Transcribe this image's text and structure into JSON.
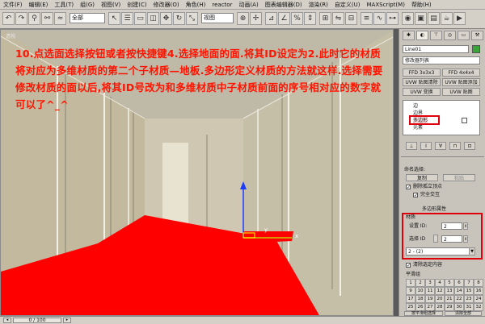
{
  "menu": [
    "文件(F)",
    "编辑(E)",
    "工具(T)",
    "组(G)",
    "视图(V)",
    "创建(C)",
    "修改器(O)",
    "角色(H)",
    "reactor",
    "动画(A)",
    "图表编辑器(D)",
    "渲染(R)",
    "自定义(U)",
    "MAXScript(M)",
    "帮助(H)"
  ],
  "toolbar": {
    "selection_filter": "全部",
    "coord_system": "视图"
  },
  "viewport": {
    "label": "透视",
    "instruction": "10.点选面选择按钮或者按快捷键4.选择地面的面.将其ID设定为2.此时它的材质将对应为多维材质的第二个子材质—地板.多边形定义材质的方法就这样.选择需要修改材质的面以后,将其ID号改为和多维材质中子材质前面的序号相对应的数字就可以了^_^",
    "axis_x": "x",
    "axis_y": "y"
  },
  "panel": {
    "object_name": "Line01",
    "modifier_list": "修改器列表",
    "btn_ffd333": "FFD 3x3x3",
    "btn_ffd444": "FFD 4x4x4",
    "btn_uvw_clear": "UVW 贴图清除",
    "btn_uvw_add": "UVW 贴图添加",
    "btn_uvw_xform": "UVW 变换",
    "btn_uvw_map": "UVW 贴图",
    "stack": [
      "边",
      "边界",
      "多边形",
      "元素"
    ],
    "named_selection": "命名选择:",
    "copy": "复制",
    "paste": "粘贴",
    "delete_isolated": "删除孤立顶点",
    "full_interact": "完全交互",
    "poly_props": "多边形属性",
    "material": "材质",
    "set_id_label": "设置 ID:",
    "set_id_value": "2",
    "select_id_label": "选择 ID",
    "select_id_value": "2",
    "submaterial": "2 - (2)",
    "clear_selection": "清除选定内容",
    "smoothing_groups": "平滑组",
    "numbers": [
      "1",
      "2",
      "3",
      "4",
      "5",
      "6",
      "7",
      "8",
      "9",
      "10",
      "11",
      "12",
      "13",
      "14",
      "15",
      "16",
      "17",
      "18",
      "19",
      "20",
      "21",
      "22",
      "23",
      "24",
      "25",
      "26",
      "27",
      "28",
      "29",
      "30",
      "31",
      "32"
    ],
    "select_by_sg": "按平滑组选择",
    "clear_all": "清除全部"
  },
  "status": {
    "frame": "0 / 100"
  },
  "colors": {
    "floor": "#ff0000",
    "instruction": "#ff1400",
    "highlight": "#e0000c"
  }
}
